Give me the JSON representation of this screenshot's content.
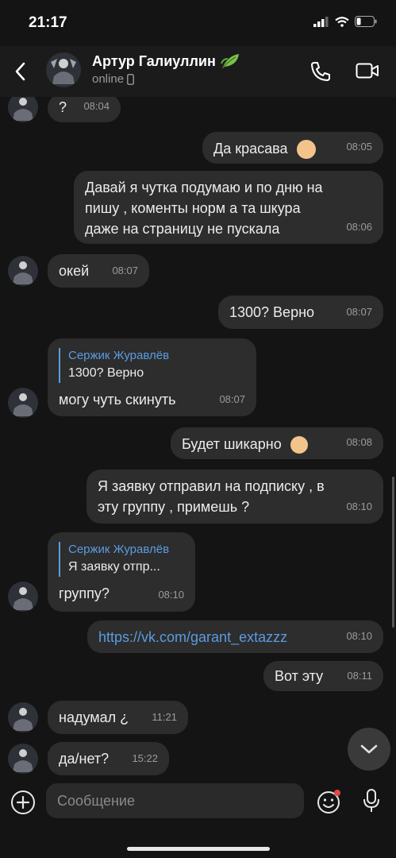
{
  "status_bar": {
    "time": "21:17"
  },
  "header": {
    "name": "Артур Галиуллин",
    "status": "online"
  },
  "messages": [
    {
      "text": "?",
      "time": "08:04"
    },
    {
      "text": "Да красава",
      "time": "08:05"
    },
    {
      "lines": [
        "Давай я чутка подумаю и по дню на",
        "пишу , коменты норм а та шкура",
        "даже на страницу не пускала"
      ],
      "time": "08:06"
    },
    {
      "text": "окей",
      "time": "08:07"
    },
    {
      "text": "1300? Верно",
      "time": "08:07"
    },
    {
      "reply_name": "Сержик Журавлёв",
      "reply_text": "1300? Верно",
      "text": "могу чуть скинуть",
      "time": "08:07"
    },
    {
      "text": "Будет шикарно",
      "time": "08:08"
    },
    {
      "lines": [
        "Я заявку отправил на подписку , в",
        "эту группу , примешь ?"
      ],
      "time": "08:10"
    },
    {
      "reply_name": "Сержик Журавлёв",
      "reply_text": "Я заявку отпр...",
      "text": "группу?",
      "time": "08:10"
    },
    {
      "text": "https://vk.com/garant_extazzz",
      "time": "08:10"
    },
    {
      "text": "Вот эту",
      "time": "08:11"
    },
    {
      "text": "надумал ¿",
      "time": "11:21"
    },
    {
      "text": "да/нет?",
      "time": "15:22"
    }
  ],
  "composer": {
    "placeholder": "Сообщение"
  },
  "colors": {
    "background": "#141414",
    "bubble": "#2d2d2d",
    "accent": "#5b9be0"
  },
  "icons": [
    "back-arrow",
    "phone",
    "video-camera",
    "plus-circle",
    "smiley",
    "microphone",
    "chevron-down"
  ]
}
